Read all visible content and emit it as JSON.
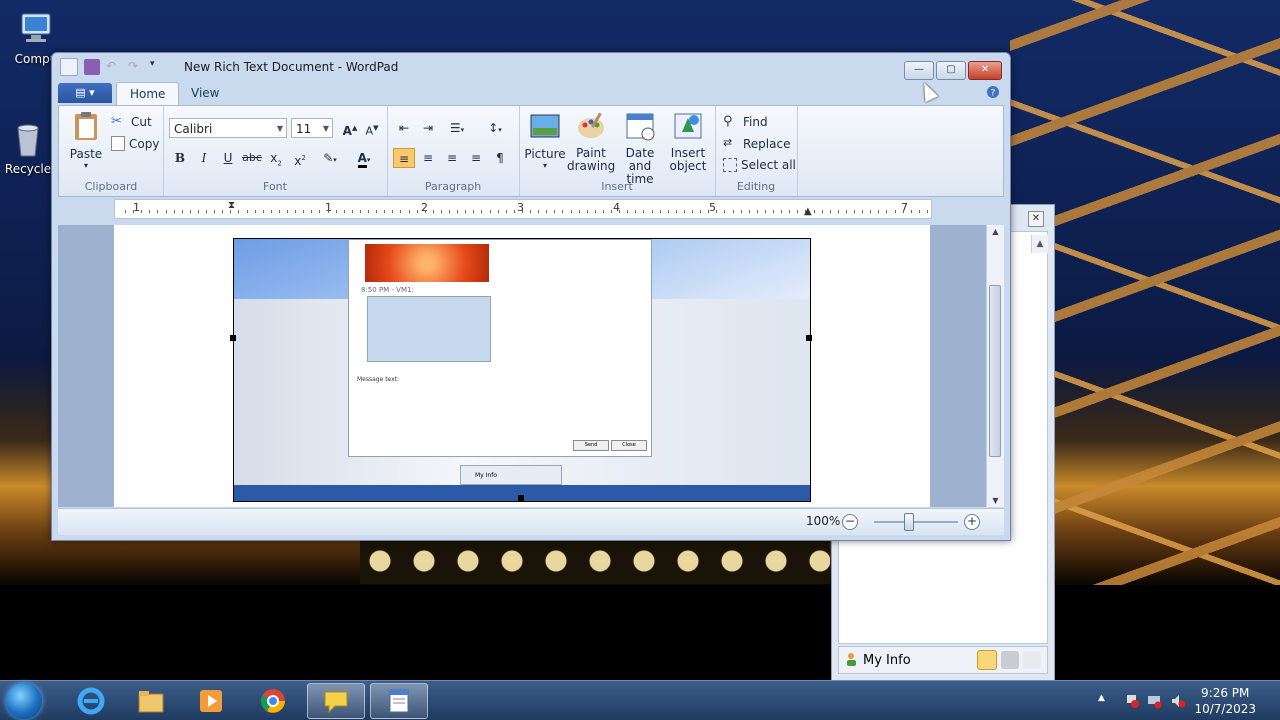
{
  "desktop": {
    "icons": [
      {
        "label": "Compu",
        "glyph": "computer-icon"
      },
      {
        "label": "Recycle",
        "glyph": "recycle-bin-icon"
      }
    ]
  },
  "messenger": {
    "myinfo_label": "My Info"
  },
  "wordpad": {
    "title": "New Rich Text Document - WordPad",
    "tabs": {
      "home": "Home",
      "view": "View"
    },
    "clipboard": {
      "paste": "Paste",
      "cut": "Cut",
      "copy": "Copy",
      "label": "Clipboard"
    },
    "font": {
      "family": "Calibri",
      "size": "11",
      "label": "Font"
    },
    "paragraph": {
      "label": "Paragraph"
    },
    "insert": {
      "picture": "Picture",
      "paint": "Paint drawing",
      "datetime": "Date and time",
      "object": "Insert object",
      "label": "Insert"
    },
    "editing": {
      "find": "Find",
      "replace": "Replace",
      "selectall": "Select all",
      "label": "Editing"
    },
    "ruler": [
      "1",
      "1",
      "2",
      "3",
      "4",
      "5",
      "7"
    ],
    "zoom": "100%"
  },
  "embedded": {
    "timestamp": "8:50 PM - VM1:",
    "message_label": "Message text:",
    "send": "Send",
    "close": "Close",
    "myinfo": "My Info"
  },
  "taskbar": {
    "time": "9:26 PM",
    "date": "10/7/2023"
  },
  "colors": {
    "accent": "#2a55a0",
    "close_red": "#c4402a"
  }
}
